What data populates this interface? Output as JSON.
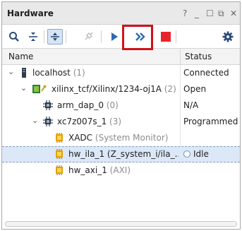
{
  "window": {
    "title": "Hardware",
    "help_glyph": "?",
    "minimize_glyph": "_",
    "maximize_glyph": "☐",
    "float_glyph": "⧉",
    "close_glyph": "✕"
  },
  "toolbar": {
    "buttons": [
      {
        "name": "search",
        "icon": "search-icon"
      },
      {
        "name": "collapse-all",
        "icon": "collapse-all-icon"
      },
      {
        "name": "expand-all",
        "icon": "expand-all-icon",
        "selected": true
      },
      {
        "name": "auto-connect",
        "icon": "plug-icon",
        "disabled": true
      },
      {
        "name": "run-trigger",
        "icon": "play-icon"
      },
      {
        "name": "run-trigger-immediate",
        "icon": "fast-forward-icon",
        "highlighted": true
      },
      {
        "name": "stop-trigger",
        "icon": "stop-icon"
      },
      {
        "name": "settings",
        "icon": "gear-icon"
      }
    ],
    "accent_color": "#2b6cb0",
    "stop_color": "#e8232b",
    "highlight_color": "#d0121b"
  },
  "table": {
    "columns": [
      "Name",
      "Status"
    ],
    "rows": [
      {
        "name": "localhost",
        "suffix": "(1)",
        "status": "Connected",
        "icon": "server-icon",
        "expanded": true
      },
      {
        "name": "xilinx_tcf/Xilinx/1234-oj1A",
        "suffix": "(2)",
        "status": "Open",
        "icon": "jtag-cable-icon",
        "expanded": true
      },
      {
        "name": "arm_dap_0",
        "suffix": "(0)",
        "status": "N/A",
        "icon": "chip-icon"
      },
      {
        "name": "xc7z007s_1",
        "suffix": "(3)",
        "status": "Programmed",
        "icon": "chip-icon",
        "expanded": true
      },
      {
        "name": "XADC",
        "suffix": "(System Monitor)",
        "status": "",
        "icon": "core-icon"
      },
      {
        "name": "hw_ila_1",
        "suffix": "(Z_system_i/ila_...",
        "status": "Idle",
        "icon": "core-icon",
        "selected": true
      },
      {
        "name": "hw_axi_1",
        "suffix": "(AXI)",
        "status": "",
        "icon": "core-icon"
      }
    ]
  }
}
